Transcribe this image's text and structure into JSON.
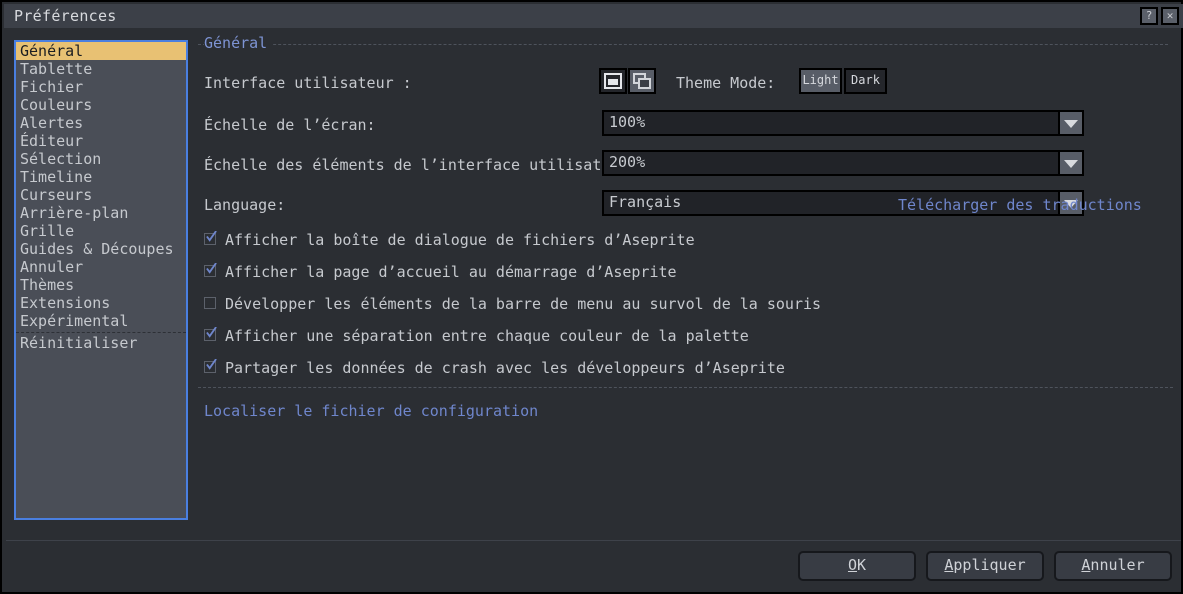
{
  "window": {
    "title": "Préférences",
    "help_icon": "question-mark-icon",
    "close_icon": "close-x-icon",
    "help_label": "?",
    "close_label": "✕",
    "accent_color": "#4a7fe0",
    "selection_color": "#e8c173",
    "link_color": "#6f86cc",
    "background_color": "#2b2e33"
  },
  "sidebar": {
    "items": [
      {
        "label": "Général",
        "selected": true
      },
      {
        "label": "Tablette",
        "selected": false
      },
      {
        "label": "Fichier",
        "selected": false
      },
      {
        "label": "Couleurs",
        "selected": false
      },
      {
        "label": "Alertes",
        "selected": false
      },
      {
        "label": "Éditeur",
        "selected": false
      },
      {
        "label": "Sélection",
        "selected": false
      },
      {
        "label": "Timeline",
        "selected": false
      },
      {
        "label": "Curseurs",
        "selected": false
      },
      {
        "label": "Arrière-plan",
        "selected": false
      },
      {
        "label": "Grille",
        "selected": false
      },
      {
        "label": "Guides & Découpes",
        "selected": false
      },
      {
        "label": "Annuler",
        "selected": false
      },
      {
        "label": "Thèmes",
        "selected": false
      },
      {
        "label": "Extensions",
        "selected": false
      },
      {
        "label": "Expérimental",
        "selected": false
      }
    ],
    "reset_label": "Réinitialiser"
  },
  "main": {
    "group_title": "Général",
    "ui_row": {
      "label": "Interface utilisateur :",
      "single_window_icon": "single-window-icon",
      "multi_window_icon": "multiple-windows-icon",
      "single_window_selected": true,
      "theme_mode_label": "Theme Mode:",
      "theme_light_label": "Light",
      "theme_dark_label": "Dark",
      "theme_selected": "Dark"
    },
    "screen_scale": {
      "label": "Échelle de l’écran:",
      "value": "100%"
    },
    "ui_elements_scale": {
      "label": "Échelle des éléments de l’interface utilisateur:",
      "value": "200%"
    },
    "language": {
      "label": "Language:",
      "value": "Français",
      "download_link": "Télécharger des traductions"
    },
    "checkboxes": [
      {
        "label": "Afficher la boîte de dialogue de fichiers d’Aseprite",
        "checked": true
      },
      {
        "label": "Afficher la page d’accueil au démarrage d’Aseprite",
        "checked": true
      },
      {
        "label": "Développer les éléments de la barre de menu au survol de la souris",
        "checked": false
      },
      {
        "label": "Afficher une séparation entre chaque couleur de la palette",
        "checked": true
      },
      {
        "label": "Partager les données de crash avec les développeurs d’Aseprite",
        "checked": true
      }
    ],
    "config_link": "Localiser le fichier de configuration"
  },
  "footer": {
    "ok": {
      "mnemonic": "O",
      "rest": "K"
    },
    "apply": {
      "mnemonic": "A",
      "rest": "ppliquer"
    },
    "cancel": {
      "mnemonic": "A",
      "rest": "nnuler"
    }
  }
}
